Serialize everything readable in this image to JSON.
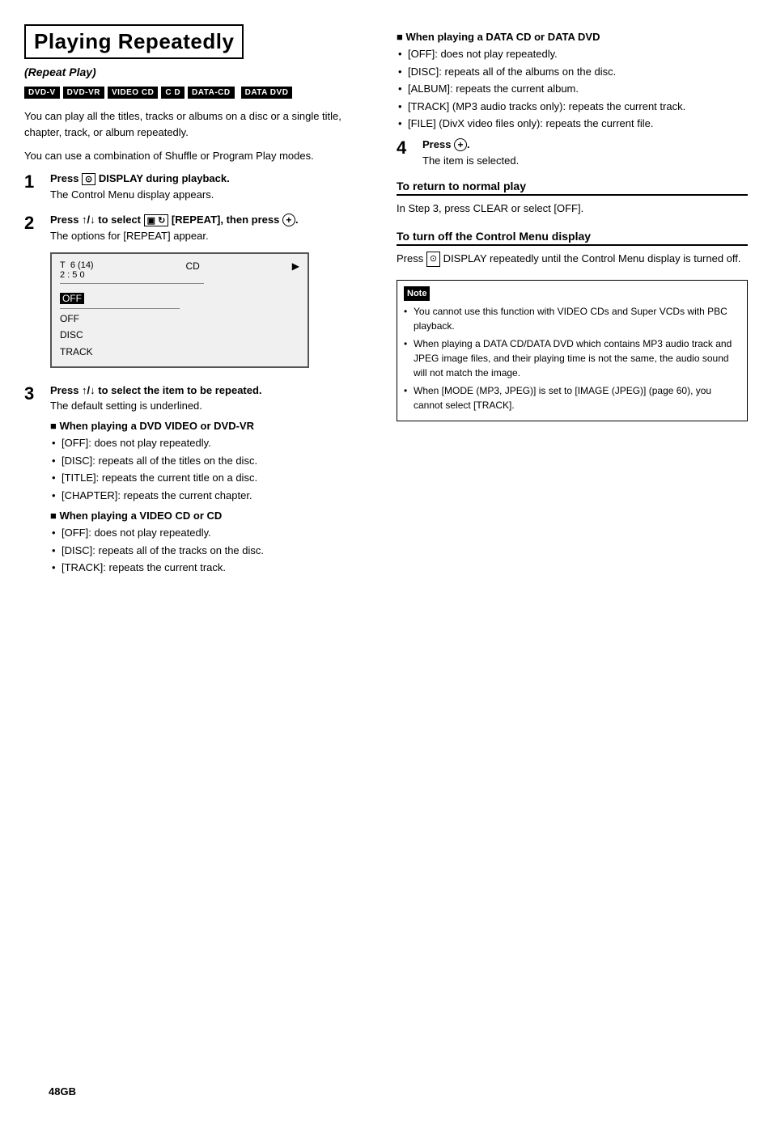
{
  "page": {
    "title": "Playing Repeatedly",
    "subtitle": "(Repeat Play)",
    "page_number": "48GB",
    "badges": [
      "DVD-V",
      "DVD-VR",
      "VIDEO CD",
      "C D",
      "DATA-CD",
      "DATA DVD"
    ],
    "intro": [
      "You can play all the titles, tracks or albums on a disc or a single title, chapter, track, or album repeatedly.",
      "You can use a combination of Shuffle or Program Play modes."
    ],
    "steps": [
      {
        "number": "1",
        "title": "Press ⊙ DISPLAY during playback.",
        "desc": "The Control Menu display appears."
      },
      {
        "number": "2",
        "title": "Press ↑/↓ to select [REPEAT], then press ⊕.",
        "desc": "The options for [REPEAT] appear."
      },
      {
        "number": "3",
        "title": "Press ↑/↓ to select the item to be repeated.",
        "desc": "The default setting is underlined.",
        "subsections": [
          {
            "heading": "When playing a DVD VIDEO or DVD-VR",
            "bullets": [
              "[OFF]: does not play repeatedly.",
              "[DISC]: repeats all of the titles on the disc.",
              "[TITLE]: repeats the current title on a disc.",
              "[CHAPTER]: repeats the current chapter."
            ]
          },
          {
            "heading": "When playing a VIDEO CD or CD",
            "bullets": [
              "[OFF]: does not play repeatedly.",
              "[DISC]: repeats all of the tracks on the disc.",
              "[TRACK]: repeats the current track."
            ]
          }
        ]
      },
      {
        "number": "4",
        "title": "Press ⊕.",
        "desc": "The item is selected."
      }
    ],
    "screen": {
      "track": "6 (14)",
      "time": "2 : 5 0",
      "track_label": "T",
      "cd_label": "CD",
      "arrow": "▶",
      "options": [
        "OFF",
        "OFF",
        "DISC",
        "TRACK"
      ]
    },
    "right_col": {
      "data_cd_section": {
        "heading": "When playing a DATA CD or DATA DVD",
        "bullets": [
          "[OFF]: does not play repeatedly.",
          "[DISC]: repeats all of the albums on the disc.",
          "[ALBUM]: repeats the current album.",
          "[TRACK] (MP3 audio tracks only): repeats the current track.",
          "[FILE] (DivX video files only): repeats the current file."
        ]
      },
      "to_return": {
        "heading": "To return to normal play",
        "text": "In Step 3, press CLEAR or select [OFF]."
      },
      "to_turn_off": {
        "heading": "To turn off the Control Menu display",
        "text": "Press ⊙ DISPLAY repeatedly until the Control Menu display is turned off."
      },
      "notes": [
        "You cannot use this function with VIDEO CDs and Super VCDs with PBC playback.",
        "When playing a DATA CD/DATA DVD which contains MP3 audio track and JPEG image files, and their playing time is not the same, the audio sound will not match the image.",
        "When [MODE (MP3, JPEG)] is set to [IMAGE (JPEG)] (page 60), you cannot select [TRACK]."
      ]
    }
  }
}
